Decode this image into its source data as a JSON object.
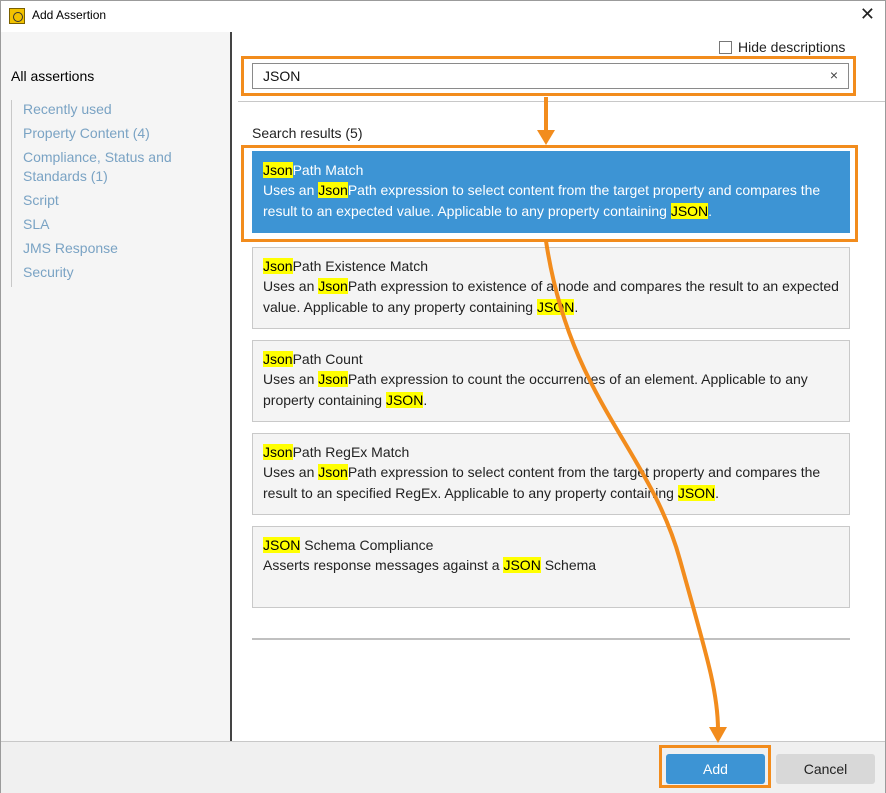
{
  "window": {
    "title": "Add Assertion"
  },
  "sidebar": {
    "heading": "All assertions",
    "items": [
      {
        "label": "Recently used"
      },
      {
        "label": "Property Content (4)"
      },
      {
        "label": "Compliance, Status and Standards (1)"
      },
      {
        "label": "Script"
      },
      {
        "label": "SLA"
      },
      {
        "label": "JMS Response"
      },
      {
        "label": "Security"
      }
    ]
  },
  "options": {
    "hide_descriptions_label": "Hide descriptions",
    "hide_descriptions_checked": false
  },
  "search": {
    "value": "JSON",
    "clear_label": "×"
  },
  "results": {
    "title": "Search results (5)",
    "selected_index": 0,
    "items": [
      {
        "name": [
          {
            "t": "Json",
            "hl": true
          },
          {
            "t": "Path Match",
            "hl": false
          }
        ],
        "desc": [
          {
            "t": "Uses an ",
            "hl": false
          },
          {
            "t": "Json",
            "hl": true
          },
          {
            "t": "Path expression to select content from the target property and compares the result to an expected value. Applicable to any property containing ",
            "hl": false
          },
          {
            "t": "JSON",
            "hl": true
          },
          {
            "t": ".",
            "hl": false
          }
        ]
      },
      {
        "name": [
          {
            "t": "Json",
            "hl": true
          },
          {
            "t": "Path Existence Match",
            "hl": false
          }
        ],
        "desc": [
          {
            "t": "Uses an ",
            "hl": false
          },
          {
            "t": "Json",
            "hl": true
          },
          {
            "t": "Path expression to existence of a node and compares the result to an expected value. Applicable to any property containing ",
            "hl": false
          },
          {
            "t": "JSON",
            "hl": true
          },
          {
            "t": ".",
            "hl": false
          }
        ]
      },
      {
        "name": [
          {
            "t": "Json",
            "hl": true
          },
          {
            "t": "Path Count",
            "hl": false
          }
        ],
        "desc": [
          {
            "t": "Uses an ",
            "hl": false
          },
          {
            "t": "Json",
            "hl": true
          },
          {
            "t": "Path expression to count the occurrences of an element. Applicable to any property containing ",
            "hl": false
          },
          {
            "t": "JSON",
            "hl": true
          },
          {
            "t": ".",
            "hl": false
          }
        ]
      },
      {
        "name": [
          {
            "t": "Json",
            "hl": true
          },
          {
            "t": "Path RegEx Match",
            "hl": false
          }
        ],
        "desc": [
          {
            "t": "Uses an ",
            "hl": false
          },
          {
            "t": "Json",
            "hl": true
          },
          {
            "t": "Path expression to select content from the target property and compares the result to an specified RegEx. Applicable to any property containing ",
            "hl": false
          },
          {
            "t": "JSON",
            "hl": true
          },
          {
            "t": ".",
            "hl": false
          }
        ]
      },
      {
        "name": [
          {
            "t": "JSON",
            "hl": true
          },
          {
            "t": " Schema Compliance",
            "hl": false
          }
        ],
        "desc": [
          {
            "t": "Asserts response messages against a ",
            "hl": false
          },
          {
            "t": "JSON",
            "hl": true
          },
          {
            "t": " Schema",
            "hl": false
          }
        ]
      }
    ]
  },
  "footer": {
    "add_label": "Add",
    "cancel_label": "Cancel"
  },
  "annotation_color": "#f28c1d",
  "accent_color": "#3d94d4"
}
